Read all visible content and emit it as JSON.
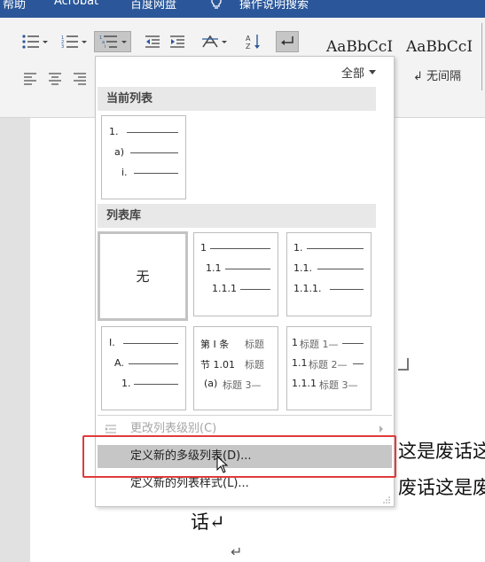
{
  "ribbon_tabs": [
    "帮助",
    "Acrobat",
    "百度网盘",
    "操作说明搜索"
  ],
  "styles_gallery": [
    {
      "sample": "AaBbCcI",
      "name": ""
    },
    {
      "sample": "AaBbCcI",
      "name": "↲ 无间隔"
    }
  ],
  "document": {
    "line1": "这是废话这",
    "line2": "废话这是废",
    "line3": "话↵",
    "para_mark": "↵"
  },
  "menu": {
    "filter_label": "全部",
    "current_list_header": "当前列表",
    "current_list": [
      "1.",
      "a)",
      "i."
    ],
    "library_header": "列表库",
    "library": [
      {
        "none_label": "无"
      },
      {
        "lines": [
          "1",
          "1.1",
          "1.1.1"
        ]
      },
      {
        "lines": [
          "1.",
          "1.1.",
          "1.1.1."
        ]
      },
      {
        "lines": [
          "I.",
          "A.",
          "1."
        ]
      },
      {
        "lines": [
          {
            "prefix": "第 Ⅰ 条",
            "caption": "标题"
          },
          {
            "prefix": "节 1.01",
            "caption": "标题"
          },
          {
            "prefix": "(a)",
            "caption": "标题 3—"
          }
        ]
      },
      {
        "lines": [
          {
            "prefix": "1",
            "caption": "标题 1—"
          },
          {
            "prefix": "1.1",
            "caption": "标题 2—"
          },
          {
            "prefix": "1.1.1",
            "caption": "标题 3—"
          }
        ]
      }
    ],
    "change_level_label": "更改列表级别(C)",
    "define_multilevel_label": "定义新的多级列表(D)...",
    "define_style_label": "定义新的列表样式(L)..."
  },
  "colors": {
    "ribbon_tab_bg": "#2b579a",
    "highlight_box": "#e03b3b",
    "hover_bg": "#c6c6c6"
  }
}
